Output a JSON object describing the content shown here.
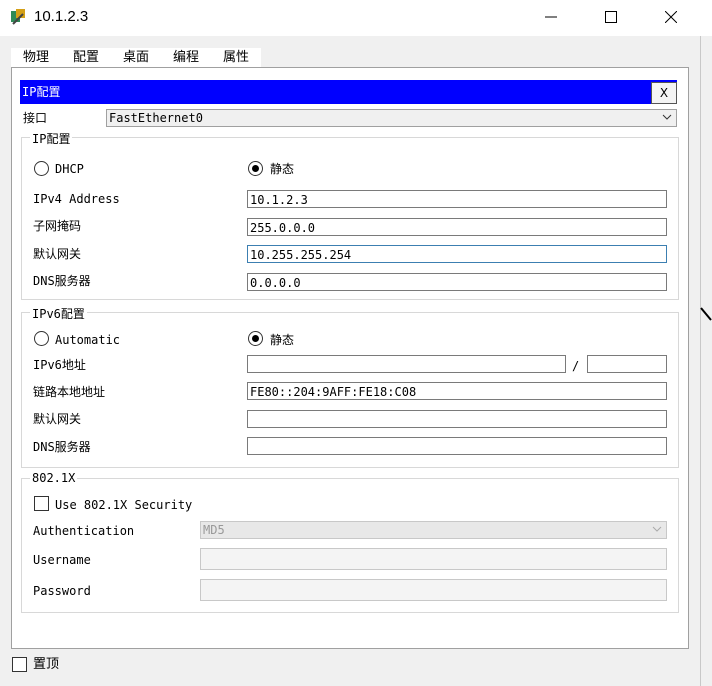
{
  "window": {
    "title": "10.1.2.3"
  },
  "tabs": [
    "物理",
    "配置",
    "桌面",
    "编程",
    "属性"
  ],
  "header": {
    "title": "IP配置",
    "close_label": "X"
  },
  "interface": {
    "label": "接口",
    "value": "FastEthernet0"
  },
  "ipv4": {
    "group_title": "IP配置",
    "dhcp_label": "DHCP",
    "static_label": "静态",
    "address_label": "IPv4 Address",
    "address_value": "10.1.2.3",
    "mask_label": "子网掩码",
    "mask_value": "255.0.0.0",
    "gateway_label": "默认网关",
    "gateway_value": "10.255.255.254",
    "dns_label": "DNS服务器",
    "dns_value": "0.0.0.0"
  },
  "ipv6": {
    "group_title": "IPv6配置",
    "auto_label": "Automatic",
    "static_label": "静态",
    "address_label": "IPv6地址",
    "address_value": "",
    "slash": "/",
    "prefix_value": "",
    "linklocal_label": "链路本地地址",
    "linklocal_value": "FE80::204:9AFF:FE18:C08",
    "gateway_label": "默认网关",
    "gateway_value": "",
    "dns_label": "DNS服务器",
    "dns_value": ""
  },
  "dot1x": {
    "group_title": "802.1X",
    "use_label": "Use 802.1X Security",
    "auth_label": "Authentication",
    "auth_value": "MD5",
    "username_label": "Username",
    "username_value": "",
    "password_label": "Password",
    "password_value": ""
  },
  "footer": {
    "pin_label": "置顶"
  }
}
